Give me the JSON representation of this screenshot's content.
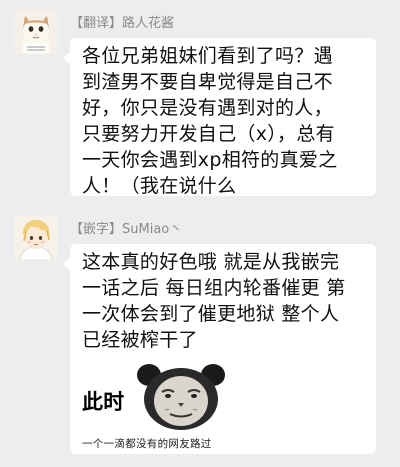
{
  "messages": [
    {
      "sender": "【翻译】路人花酱",
      "avatar_icon": "cat-avatar-icon",
      "text": "各位兄弟姐妹们看到了吗？遇\n到渣男不要自卑觉得是自己不\n好，你只是没有遇到对的人，\n只要努力开发自己（x），总有\n一天你会遇到xp相符的真爱之\n人！（我在说什么"
    },
    {
      "sender": "【嵌字】SuMiao丶",
      "avatar_icon": "blond-character-avatar-icon",
      "text": "这本真的好色哦 就是从我嵌完\n一话之后 每日组内轮番催更 第\n一次体会到了催更地狱 整个人\n已经被榨干了",
      "sticker": {
        "icon": "panda-meme-face-icon",
        "big_text": "此时",
        "caption": "一个一滴都没有的网友路过"
      }
    }
  ]
}
